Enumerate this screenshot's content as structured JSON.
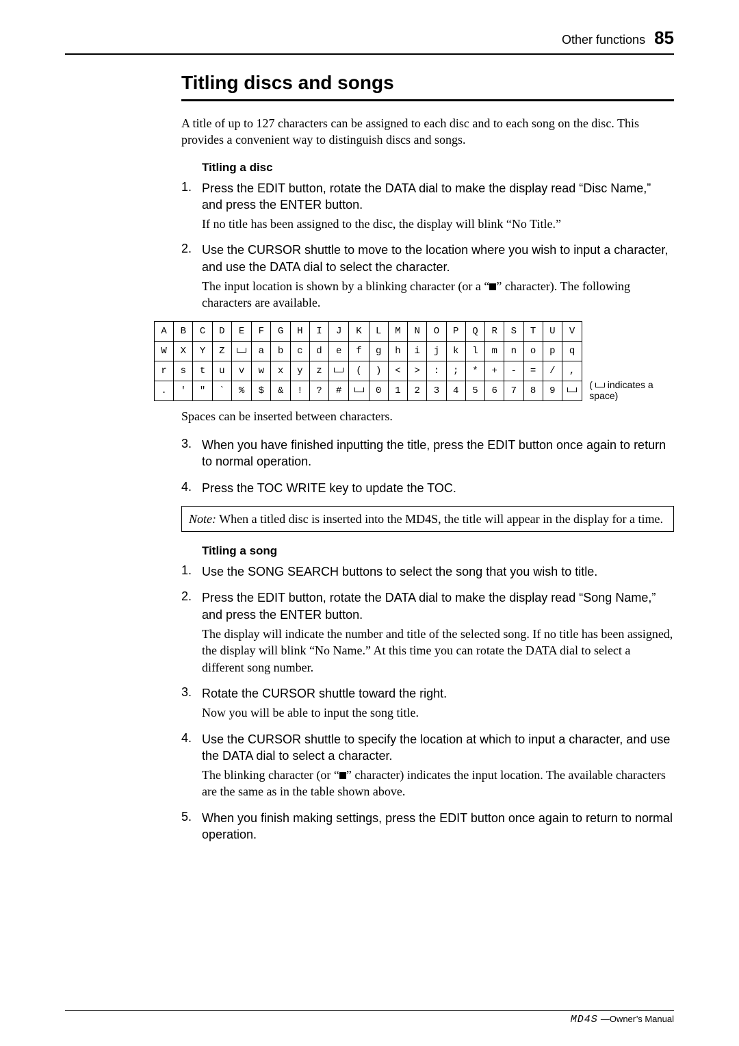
{
  "header": {
    "section": "Other functions",
    "page_number": "85"
  },
  "title": "Titling discs and songs",
  "intro": "A title of up to 127 characters can be assigned to each disc and to each song on the disc. This provides a convenient way to distinguish discs and songs.",
  "disc": {
    "heading": "Titling a disc",
    "steps": [
      {
        "n": "1.",
        "main": "Press the EDIT button, rotate the DATA dial to make the display read “Disc Name,” and press the ENTER button.",
        "body": "If no title has been assigned to the disc, the display will blink “No Title.”"
      },
      {
        "n": "2.",
        "main": "Use the CURSOR shuttle to move to the location where you wish to input a character, and use the DATA dial to select the character.",
        "body_a": "The input location is shown by a blinking character (or a “",
        "body_b": "” character). The following characters are available."
      },
      {
        "n": "3.",
        "main": "When you have finished inputting the title, press the EDIT button once again to return to normal operation."
      },
      {
        "n": "4.",
        "main": "Press the TOC WRITE key to update the TOC."
      }
    ],
    "after_table": "Spaces can be inserted between characters.",
    "table_note_a": "(",
    "table_note_b": " indicates a space)"
  },
  "char_table": [
    [
      "A",
      "B",
      "C",
      "D",
      "E",
      "F",
      "G",
      "H",
      "I",
      "J",
      "K",
      "L",
      "M",
      "N",
      "O",
      "P",
      "Q",
      "R",
      "S",
      "T",
      "U",
      "V"
    ],
    [
      "W",
      "X",
      "Y",
      "Z",
      "␣",
      "a",
      "b",
      "c",
      "d",
      "e",
      "f",
      "g",
      "h",
      "i",
      "j",
      "k",
      "l",
      "m",
      "n",
      "o",
      "p",
      "q"
    ],
    [
      "r",
      "s",
      "t",
      "u",
      "v",
      "w",
      "x",
      "y",
      "z",
      "␣",
      "(",
      ")",
      "<",
      ">",
      ":",
      ";",
      "*",
      "+",
      "-",
      "=",
      "/",
      ","
    ],
    [
      ".",
      "'",
      "\"",
      "`",
      "%",
      "$",
      "&",
      "!",
      "?",
      "#",
      "␣",
      "0",
      "1",
      "2",
      "3",
      "4",
      "5",
      "6",
      "7",
      "8",
      "9",
      "␣"
    ]
  ],
  "note": {
    "label": "Note:",
    "text": " When a titled disc is inserted into the MD4S, the title will appear in the display for a time."
  },
  "song": {
    "heading": "Titling a song",
    "steps": [
      {
        "n": "1.",
        "main": "Use the SONG SEARCH buttons to select the song that you wish to title."
      },
      {
        "n": "2.",
        "main": "Press the EDIT button, rotate the DATA dial to make the display read “Song Name,” and press the ENTER button.",
        "body": "The display will indicate the number and title of the selected song. If no title has been assigned, the display will blink “No Name.” At this time you can rotate the DATA dial to select a different song number."
      },
      {
        "n": "3.",
        "main": "Rotate the CURSOR shuttle toward the right.",
        "body": "Now you will be able to input the song title."
      },
      {
        "n": "4.",
        "main": "Use the CURSOR shuttle to specify the location at which to input a character, and use the DATA dial to select a character.",
        "body_a": "The blinking character (or “",
        "body_b": "” character) indicates the input location. The available characters are the same as in the table shown above."
      },
      {
        "n": "5.",
        "main": "When you finish making settings, press the EDIT button once again to return to normal operation."
      }
    ]
  },
  "footer": {
    "model": "MD4S",
    "text": "—Owner’s Manual"
  }
}
